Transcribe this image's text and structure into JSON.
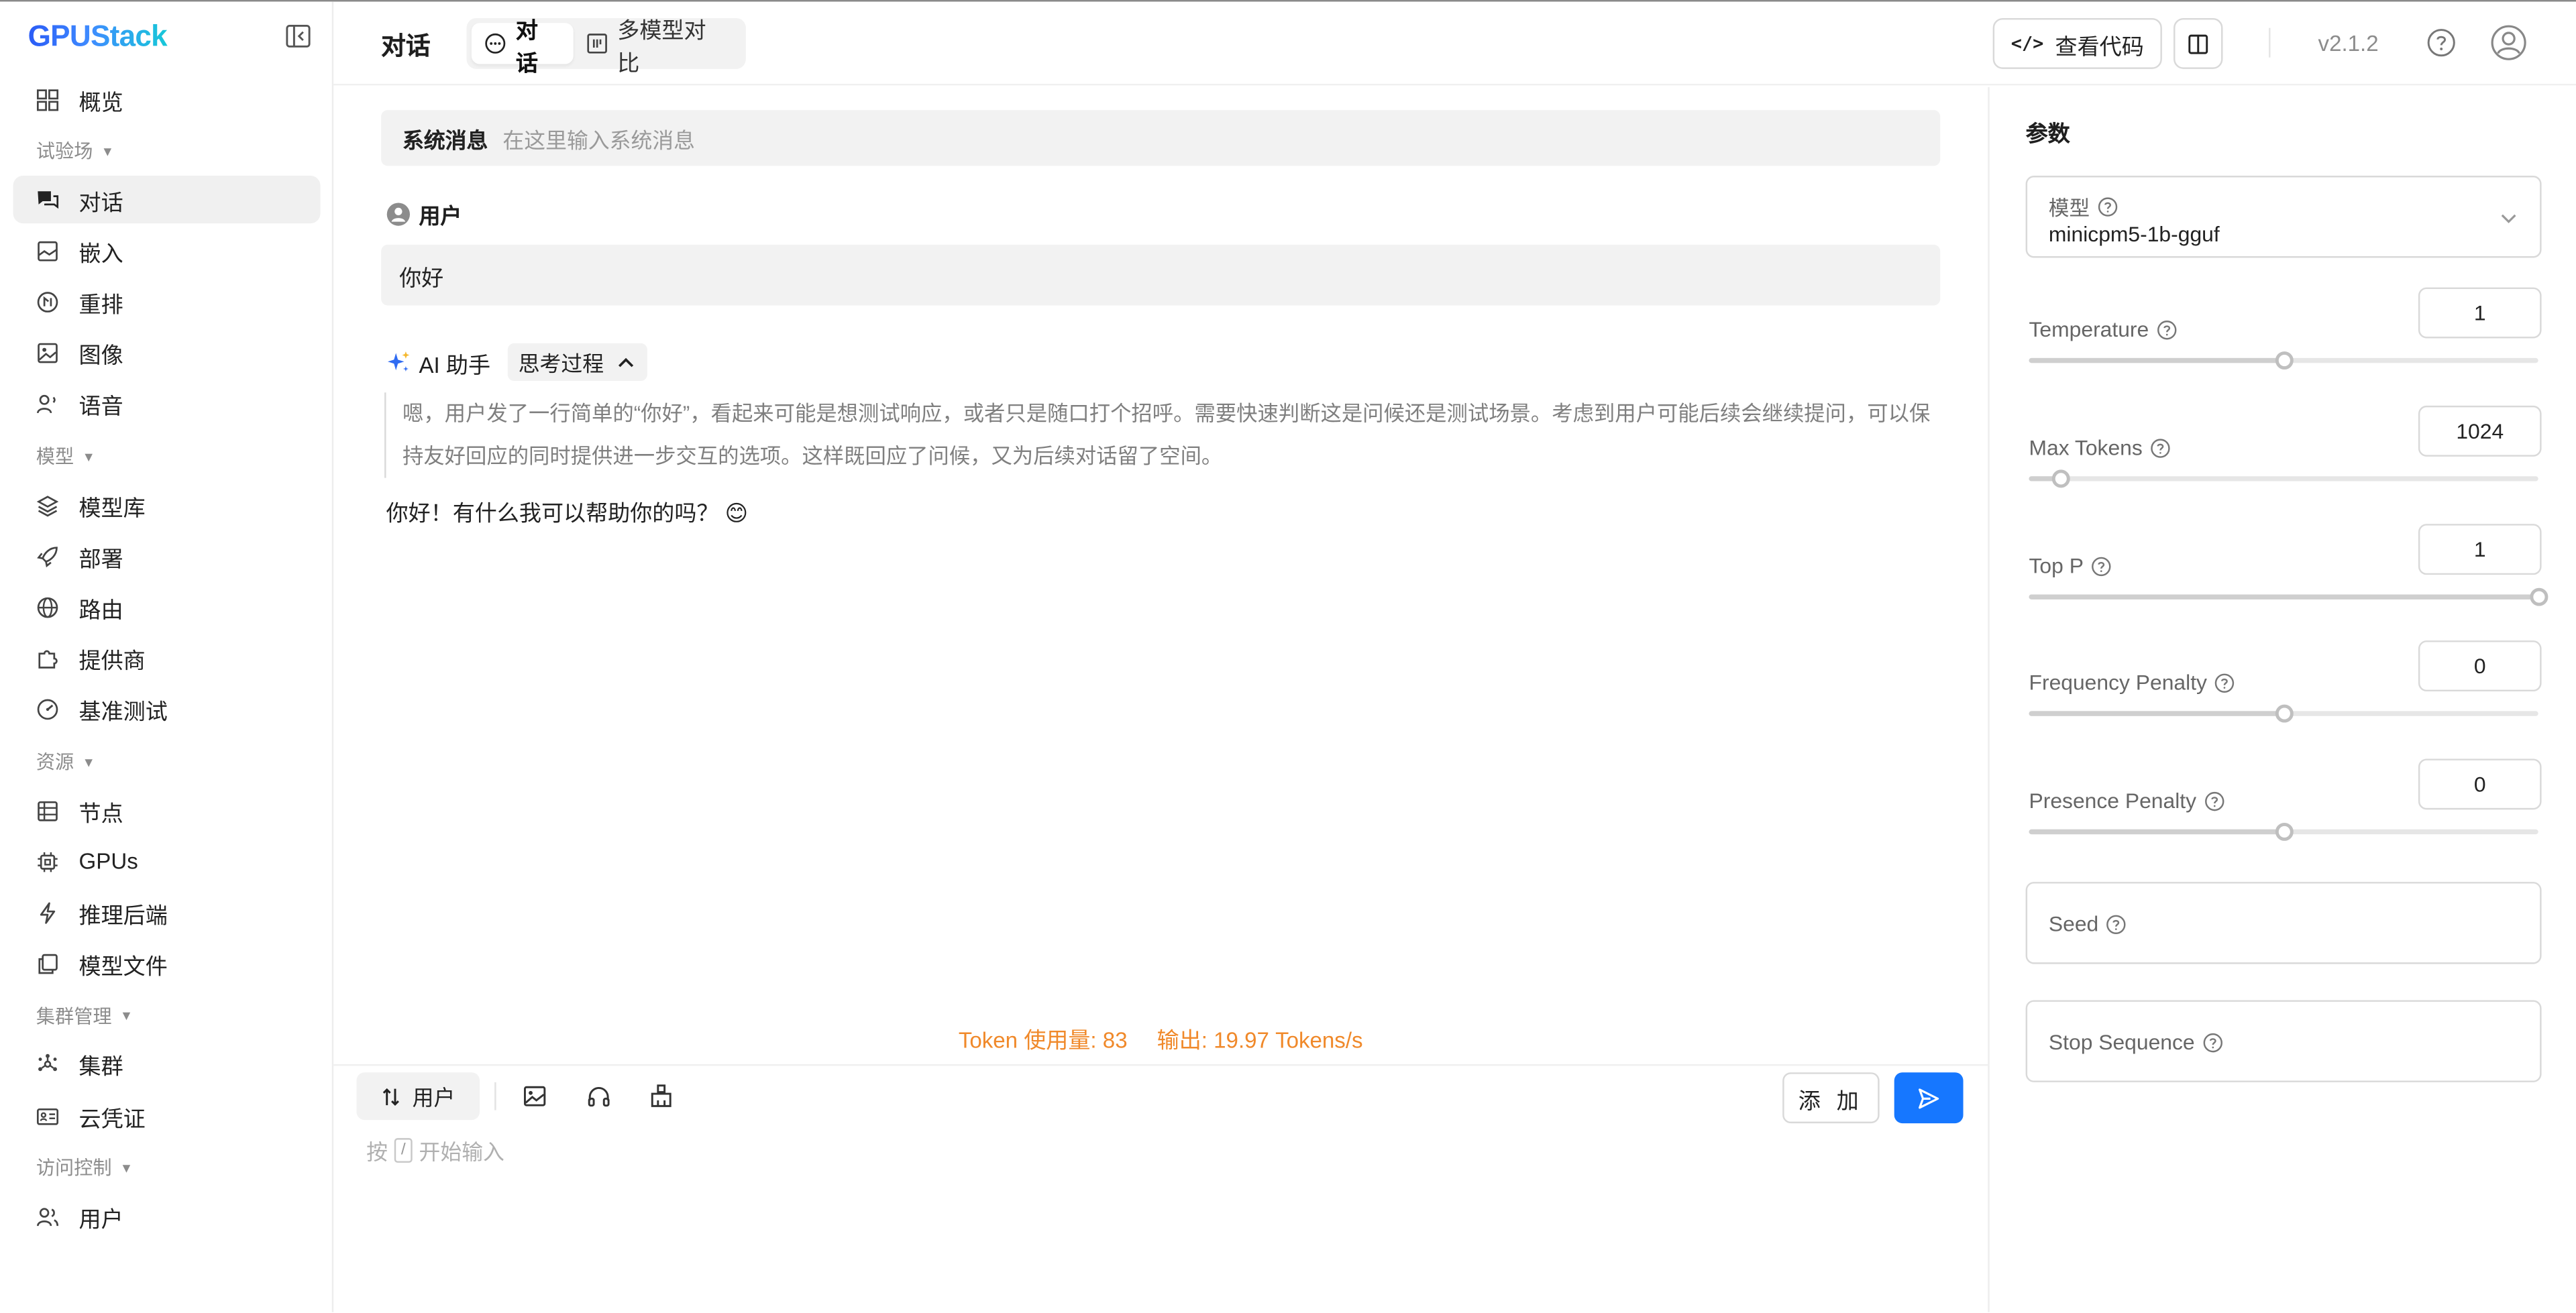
{
  "app": {
    "logo_text": "GPUStack",
    "version": "v2.1.2"
  },
  "sidebar": {
    "overview": "概览",
    "groups": {
      "playground": "试验场",
      "models": "模型",
      "resources": "资源",
      "cluster_mgmt": "集群管理",
      "access": "访问控制"
    },
    "items": {
      "chat": "对话",
      "embed": "嵌入",
      "rerank": "重排",
      "image": "图像",
      "audio": "语音",
      "catalog": "模型库",
      "deploy": "部署",
      "routes": "路由",
      "providers": "提供商",
      "benchmark": "基准测试",
      "nodes": "节点",
      "gpus": "GPUs",
      "backends": "推理后端",
      "model_files": "模型文件",
      "clusters": "集群",
      "credentials": "云凭证",
      "users": "用户"
    }
  },
  "header": {
    "title": "对话",
    "tabs": [
      "对话",
      "多模型对比"
    ],
    "view_code": "查看代码"
  },
  "chat": {
    "system_label": "系统消息",
    "system_placeholder": "在这里输入系统消息",
    "user_role": "用户",
    "user_message": "你好",
    "ai_role": "AI 助手",
    "thinking_toggle": "思考过程",
    "thinking_text": "嗯，用户发了一行简单的“你好”，看起来可能是想测试响应，或者只是随口打个招呼。需要快速判断这是问候还是测试场景。考虑到用户可能后续会继续提问，可以保持友好回应的同时提供进一步交互的选项。这样既回应了问候，又为后续对话留了空间。",
    "answer": "你好！有什么我可以帮助你的吗？ 😊",
    "token_usage": "Token 使用量: 83",
    "output_speed": "输出: 19.97 Tokens/s",
    "role_switch": "用户",
    "add_button": "添 加",
    "input_hint_before": "按",
    "input_hint_key": "/",
    "input_hint_after": "开始输入"
  },
  "params": {
    "title": "参数",
    "model_label": "模型",
    "model_value": "minicpm5-1b-gguf",
    "temperature": {
      "label": "Temperature",
      "value": "1",
      "level": 0.5
    },
    "max_tokens": {
      "label": "Max Tokens",
      "value": "1024",
      "level": 0.062
    },
    "top_p": {
      "label": "Top P",
      "value": "1",
      "level": 1.0
    },
    "frequency_penalty": {
      "label": "Frequency Penalty",
      "value": "0",
      "level": 0.5
    },
    "presence_penalty": {
      "label": "Presence Penalty",
      "value": "0",
      "level": 0.5
    },
    "seed_label": "Seed",
    "stop_label": "Stop Sequence"
  },
  "colors": {
    "accent": "#1677ff",
    "token_info": "#f0892a"
  }
}
